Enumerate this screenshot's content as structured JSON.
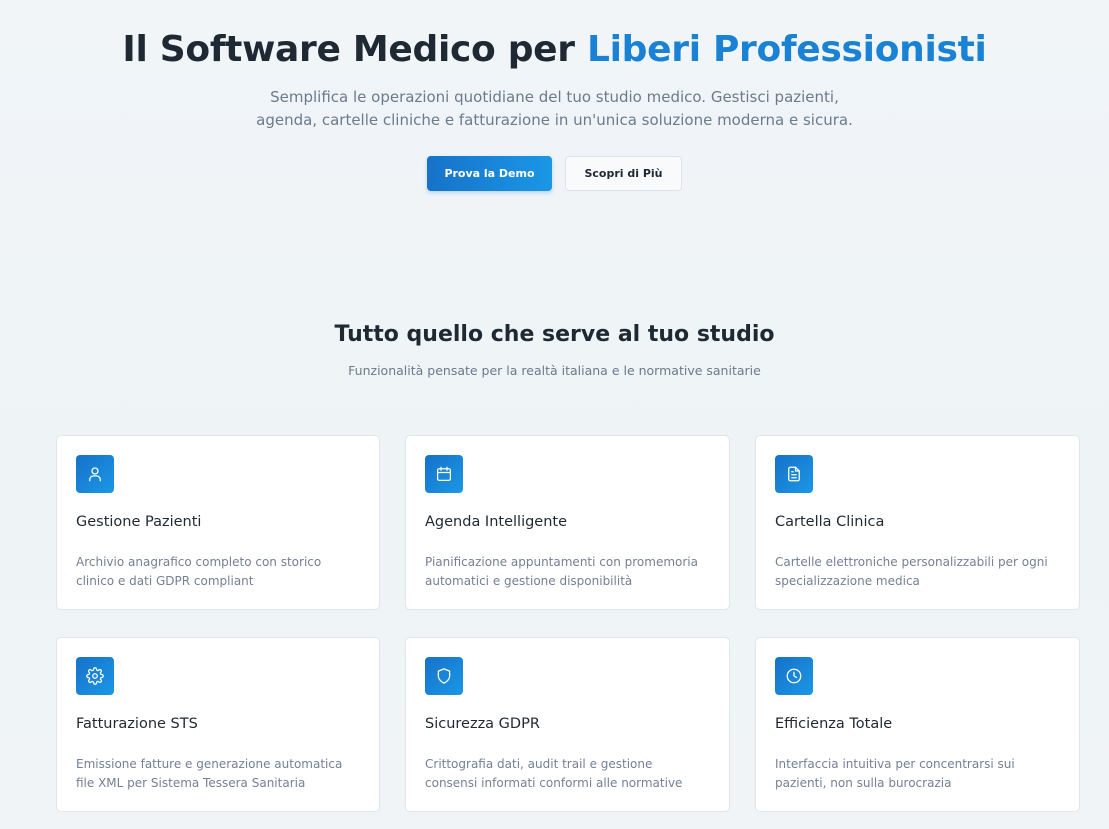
{
  "hero": {
    "title_main": "Il Software Medico per ",
    "title_accent": "Liberi Professionisti",
    "subtitle": "Semplifica le operazioni quotidiane del tuo studio medico. Gestisci pazienti, agenda, cartelle cliniche e fatturazione in un'unica soluzione moderna e sicura.",
    "primary_button": "Prova la Demo",
    "secondary_button": "Scopri di Più"
  },
  "features": {
    "title": "Tutto quello che serve al tuo studio",
    "subtitle": "Funzionalità pensate per la realtà italiana e le normative sanitarie",
    "cards": [
      {
        "icon": "user-icon",
        "title": "Gestione Pazienti",
        "description": "Archivio anagrafico completo con storico clinico e dati GDPR compliant"
      },
      {
        "icon": "calendar-icon",
        "title": "Agenda Intelligente",
        "description": "Pianificazione appuntamenti con promemoria automatici e gestione disponibilità"
      },
      {
        "icon": "document-icon",
        "title": "Cartella Clinica",
        "description": "Cartelle elettroniche personalizzabili per ogni specializzazione medica"
      },
      {
        "icon": "gear-icon",
        "title": "Fatturazione STS",
        "description": "Emissione fatture e generazione automatica file XML per Sistema Tessera Sanitaria"
      },
      {
        "icon": "shield-icon",
        "title": "Sicurezza GDPR",
        "description": "Crittografia dati, audit trail e gestione consensi informati conformi alle normative"
      },
      {
        "icon": "clock-icon",
        "title": "Efficienza Totale",
        "description": "Interfaccia intuitiva per concentrarsi sui pazienti, non sulla burocrazia"
      }
    ]
  },
  "colors": {
    "accent": "#1a82d4",
    "background": "#eef3f6",
    "heading": "#1f2933",
    "muted_text": "#6b7a8c"
  }
}
